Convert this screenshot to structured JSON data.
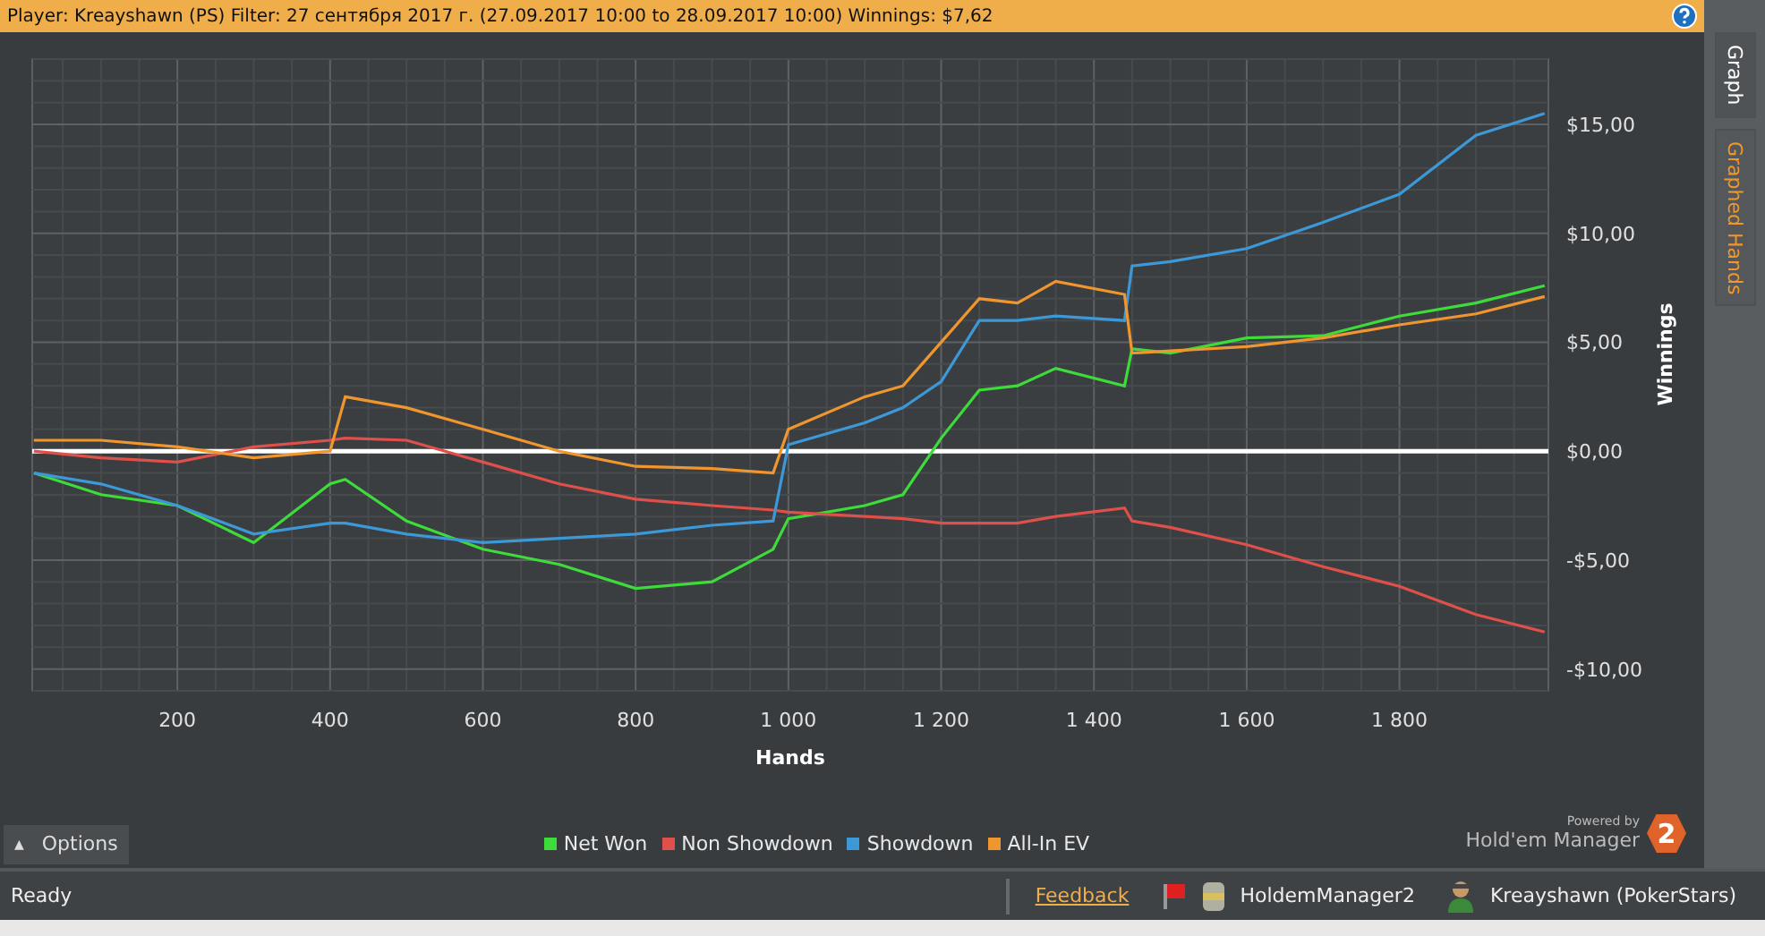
{
  "header": {
    "title": "Player: Kreayshawn (PS) Filter: 27 сентября 2017 г. (27.09.2017 10:00 to 28.09.2017 10:00) Winnings: $7,62"
  },
  "side_tabs": [
    {
      "label": "Graph",
      "selected": true
    },
    {
      "label": "Graphed Hands",
      "selected": false
    }
  ],
  "graph": {
    "chart_data": {
      "type": "line",
      "xlabel": "Hands",
      "ylabel": "Winnings",
      "x": [
        12,
        100,
        200,
        300,
        400,
        420,
        500,
        600,
        700,
        800,
        900,
        980,
        1000,
        1100,
        1150,
        1200,
        1250,
        1300,
        1350,
        1440,
        1450,
        1500,
        1600,
        1700,
        1800,
        1900,
        1990
      ],
      "series": [
        {
          "name": "Net Won",
          "color": "#3ddc3a",
          "values": [
            -1,
            -2,
            -2.5,
            -4.2,
            -1.5,
            -1.3,
            -3.2,
            -4.5,
            -5.2,
            -6.3,
            -6,
            -4.5,
            -3.1,
            -2.5,
            -2,
            0.6,
            2.8,
            3,
            3.8,
            3,
            4.7,
            4.5,
            5.2,
            5.3,
            6.2,
            6.8,
            7.6
          ]
        },
        {
          "name": "Non Showdown",
          "color": "#e0504a",
          "values": [
            0,
            -0.3,
            -0.5,
            0.2,
            0.5,
            0.6,
            0.5,
            -0.5,
            -1.5,
            -2.2,
            -2.5,
            -2.7,
            -2.8,
            -3,
            -3.1,
            -3.3,
            -3.3,
            -3.3,
            -3,
            -2.6,
            -3.2,
            -3.5,
            -4.3,
            -5.3,
            -6.2,
            -7.5,
            -8.3
          ]
        },
        {
          "name": "Showdown",
          "color": "#3d98d8",
          "values": [
            -1,
            -1.5,
            -2.5,
            -3.8,
            -3.3,
            -3.3,
            -3.8,
            -4.2,
            -4,
            -3.8,
            -3.4,
            -3.2,
            0.3,
            1.3,
            2,
            3.2,
            6,
            6,
            6.2,
            6,
            8.5,
            8.7,
            9.3,
            10.5,
            11.8,
            14.5,
            15.5
          ]
        },
        {
          "name": "All-In EV",
          "color": "#f0962e",
          "values": [
            0.5,
            0.5,
            0.2,
            -0.3,
            0,
            2.5,
            2,
            1,
            0,
            -0.7,
            -0.8,
            -1,
            1,
            2.5,
            3,
            5,
            7,
            6.8,
            7.8,
            7.2,
            4.5,
            4.6,
            4.8,
            5.2,
            5.8,
            6.3,
            7.1
          ]
        }
      ],
      "grid": true,
      "xlim": [
        10,
        1995
      ],
      "ylim": [
        -11,
        18
      ],
      "xticks": [
        {
          "value": 200,
          "label": "200"
        },
        {
          "value": 400,
          "label": "400"
        },
        {
          "value": 600,
          "label": "600"
        },
        {
          "value": 800,
          "label": "800"
        },
        {
          "value": 1000,
          "label": "1 000"
        },
        {
          "value": 1200,
          "label": "1 200"
        },
        {
          "value": 1400,
          "label": "1 400"
        },
        {
          "value": 1600,
          "label": "1 600"
        },
        {
          "value": 1800,
          "label": "1 800"
        }
      ],
      "yticks": [
        {
          "value": -10,
          "label": "-$10,00"
        },
        {
          "value": -5,
          "label": "-$5,00"
        },
        {
          "value": 0,
          "label": "$0,00"
        },
        {
          "value": 5,
          "label": "$5,00"
        },
        {
          "value": 10,
          "label": "$10,00"
        },
        {
          "value": 15,
          "label": "$15,00"
        }
      ]
    }
  },
  "options_button": {
    "label": "Options",
    "icon": "▲"
  },
  "branding": {
    "powered_by": "Powered by",
    "product": "Hold'em Manager",
    "badge": "2"
  },
  "status_bar": {
    "status": "Ready",
    "link": "Feedback",
    "database": "HoldemManager2",
    "player": "Kreayshawn (PokerStars)"
  }
}
